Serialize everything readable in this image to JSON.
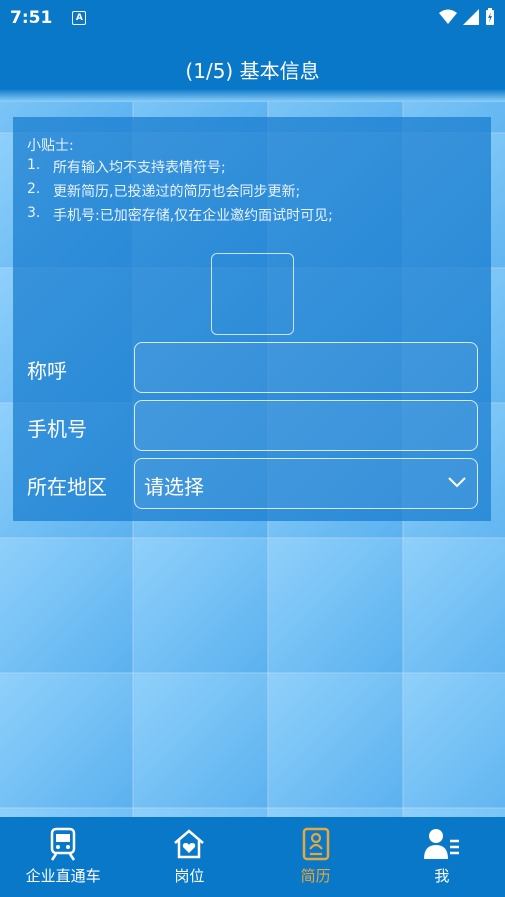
{
  "status_bar": {
    "time": "7:51",
    "notification_icon": "A"
  },
  "header": {
    "title": "(1/5) 基本信息"
  },
  "tips": {
    "title": "小贴士:",
    "items": [
      {
        "num": "1.",
        "text": "所有输入均不支持表情符号;"
      },
      {
        "num": "2.",
        "text": "更新简历,已投递过的简历也会同步更新;"
      },
      {
        "num": "3.",
        "text": "手机号:已加密存储,仅在企业邀约面试时可见;"
      }
    ]
  },
  "form": {
    "name_label": "称呼",
    "name_value": "",
    "phone_label": "手机号",
    "phone_value": "",
    "region_label": "所在地区",
    "region_value": "请选择"
  },
  "tabs": [
    {
      "label": "企业直通车",
      "icon": "train-icon",
      "active": false
    },
    {
      "label": "岗位",
      "icon": "home-heart-icon",
      "active": false
    },
    {
      "label": "简历",
      "icon": "resume-icon",
      "active": true
    },
    {
      "label": "我",
      "icon": "user-icon",
      "active": false
    }
  ],
  "colors": {
    "primary": "#0a78c9",
    "active_tab": "#e9a73a",
    "panel": "#177ccf"
  }
}
